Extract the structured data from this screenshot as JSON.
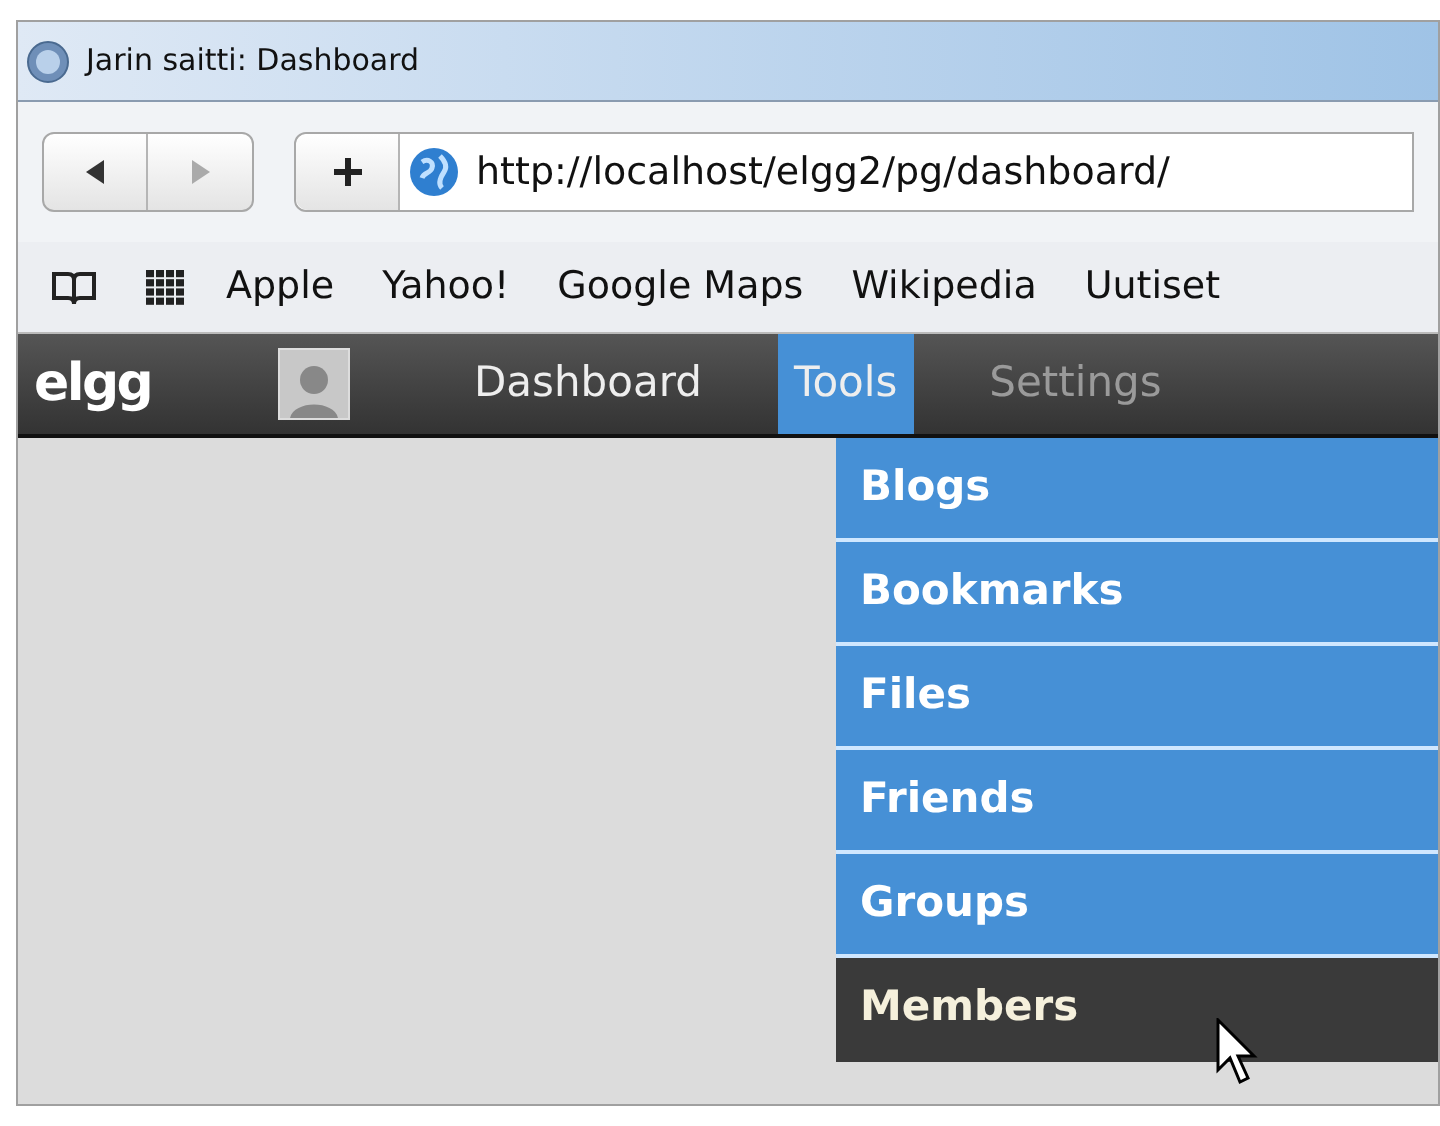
{
  "window": {
    "title": "Jarin saitti: Dashboard"
  },
  "address_bar": {
    "value": "http://localhost/elgg2/pg/dashboard/"
  },
  "bookmarks": [
    "Apple",
    "Yahoo!",
    "Google Maps",
    "Wikipedia",
    "Uutiset"
  ],
  "site_nav": {
    "logo": "elgg",
    "items": [
      {
        "label": "Dashboard",
        "selected": false,
        "disabled": false
      },
      {
        "label": "Tools",
        "selected": true,
        "disabled": false
      },
      {
        "label": "Settings",
        "selected": false,
        "disabled": true
      }
    ]
  },
  "tools_menu": [
    {
      "label": "Blogs",
      "selected": false
    },
    {
      "label": "Bookmarks",
      "selected": false
    },
    {
      "label": "Files",
      "selected": false
    },
    {
      "label": "Friends",
      "selected": false
    },
    {
      "label": "Groups",
      "selected": false
    },
    {
      "label": "Members",
      "selected": true
    }
  ]
}
